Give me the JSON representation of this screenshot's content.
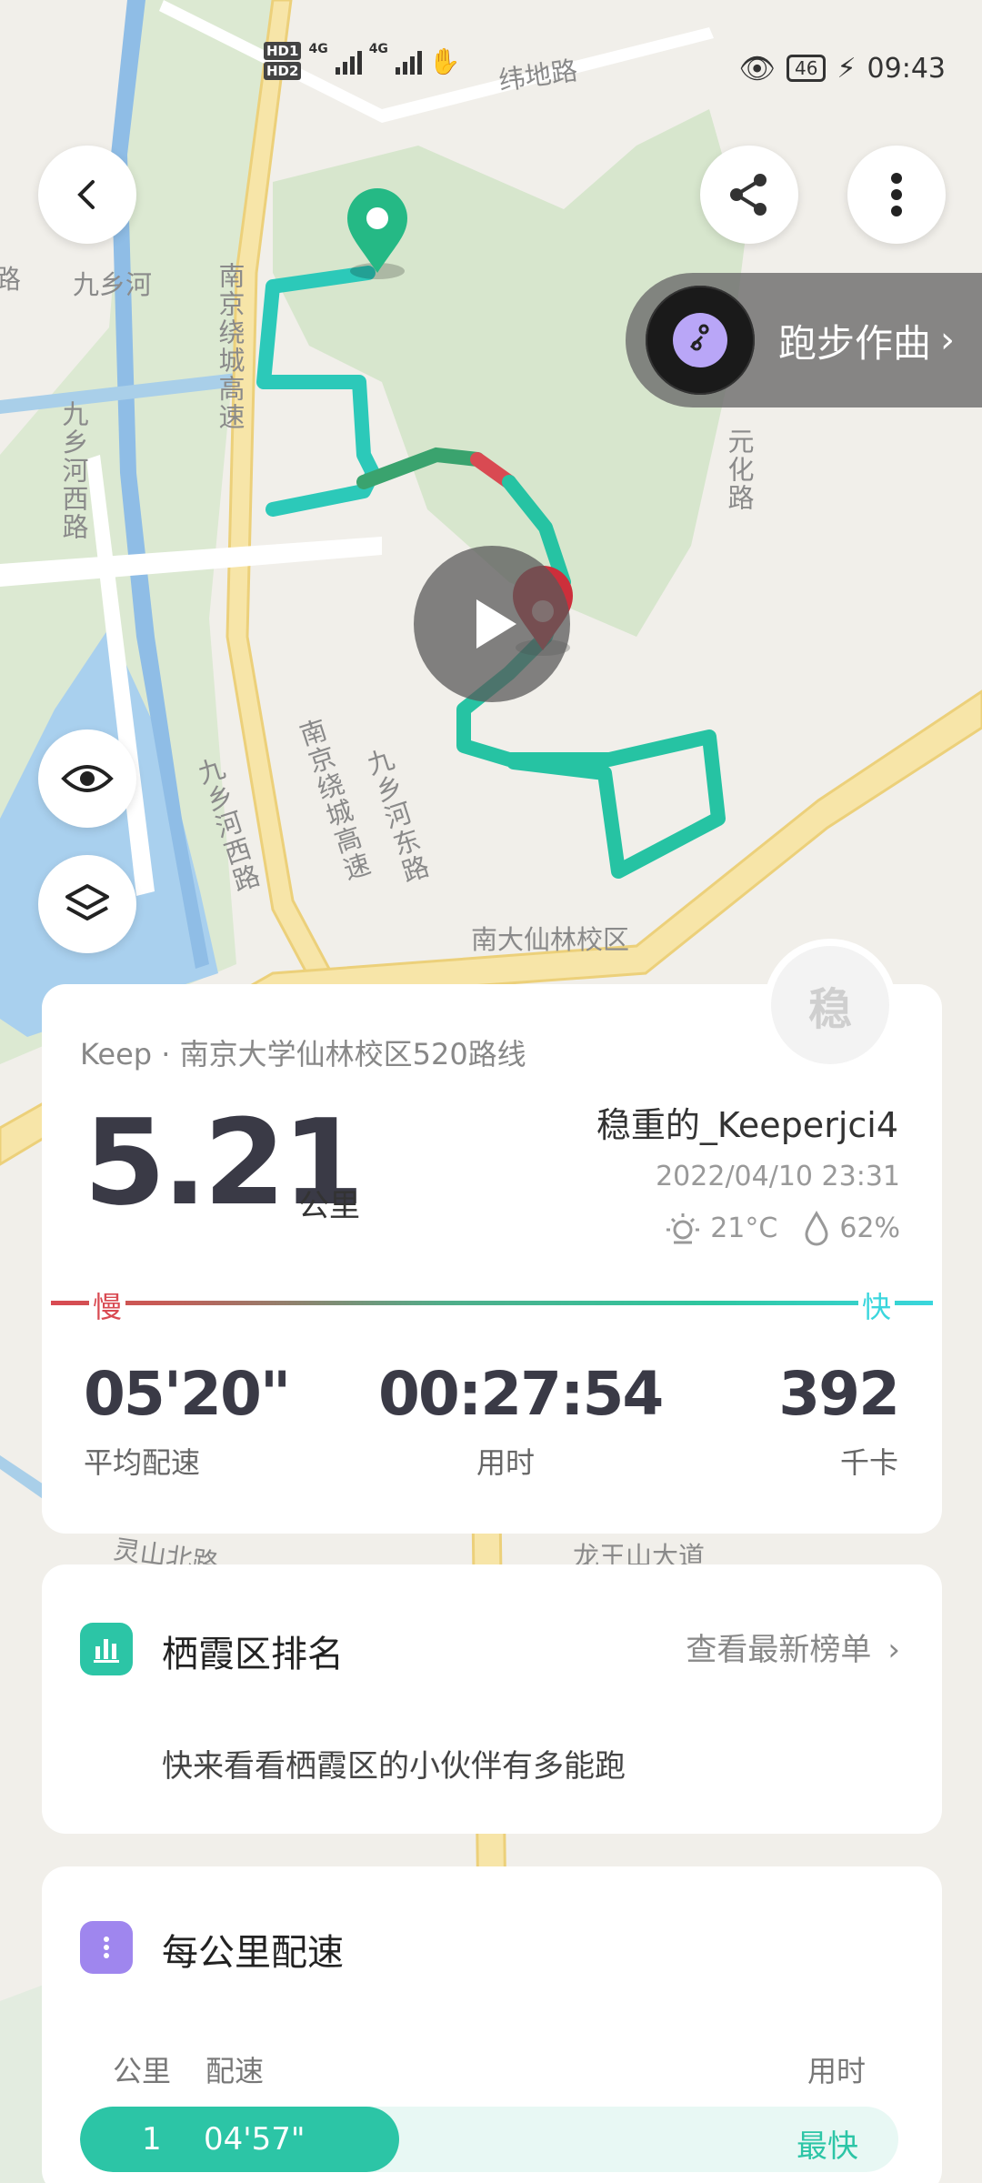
{
  "status_bar": {
    "hd1": "HD",
    "hd1_slot": "1",
    "hd2": "HD",
    "hd2_slot": "2",
    "net1": "4G",
    "net2": "4G",
    "battery": "46",
    "time": "09:43"
  },
  "map": {
    "labels": {
      "weidi_road": "纬地路",
      "jiuxiang_river": "九乡河",
      "jiuxiang_west_road_1": "九乡河西路",
      "nanjing_ring_1": "南京绕城高速",
      "yuanhua_road": "元化路",
      "jiuxiang_west_road_2": "九乡河西路",
      "nanjing_ring_2": "南京绕城高速",
      "jiuxiang_east_road": "九乡河东路",
      "campus": "南大仙林校区",
      "lingshan": "灵山北路",
      "longwangshan": "龙王山大道",
      "left_edge": "路"
    }
  },
  "music": {
    "label": "跑步作曲",
    "icon": "music-compose-icon"
  },
  "summary": {
    "badge": "稳",
    "route": "Keep  ·  南京大学仙林校区520路线",
    "distance": "5.21",
    "distance_unit": "公里",
    "username": "稳重的_Keeperjci4",
    "datetime": "2022/04/10 23:31",
    "temperature": "21°C",
    "humidity": "62%",
    "slow_label": "慢",
    "fast_label": "快",
    "avg_pace": "05'20\"",
    "avg_pace_label": "平均配速",
    "duration": "00:27:54",
    "duration_label": "用时",
    "calories": "392",
    "calories_label": "千卡"
  },
  "rank": {
    "title": "栖霞区排名",
    "more": "查看最新榜单",
    "desc": "快来看看栖霞区的小伙伴有多能跑"
  },
  "pace": {
    "title": "每公里配速",
    "col_km": "公里",
    "col_pace": "配速",
    "col_time": "用时",
    "rows": [
      {
        "km": "1",
        "pace": "04'57\"",
        "tag": "最快",
        "fraction": 0.39
      }
    ]
  },
  "colors": {
    "route_start": "#2fc4a3",
    "route_slow": "#d94a52",
    "accent": "#2cc5a6"
  }
}
